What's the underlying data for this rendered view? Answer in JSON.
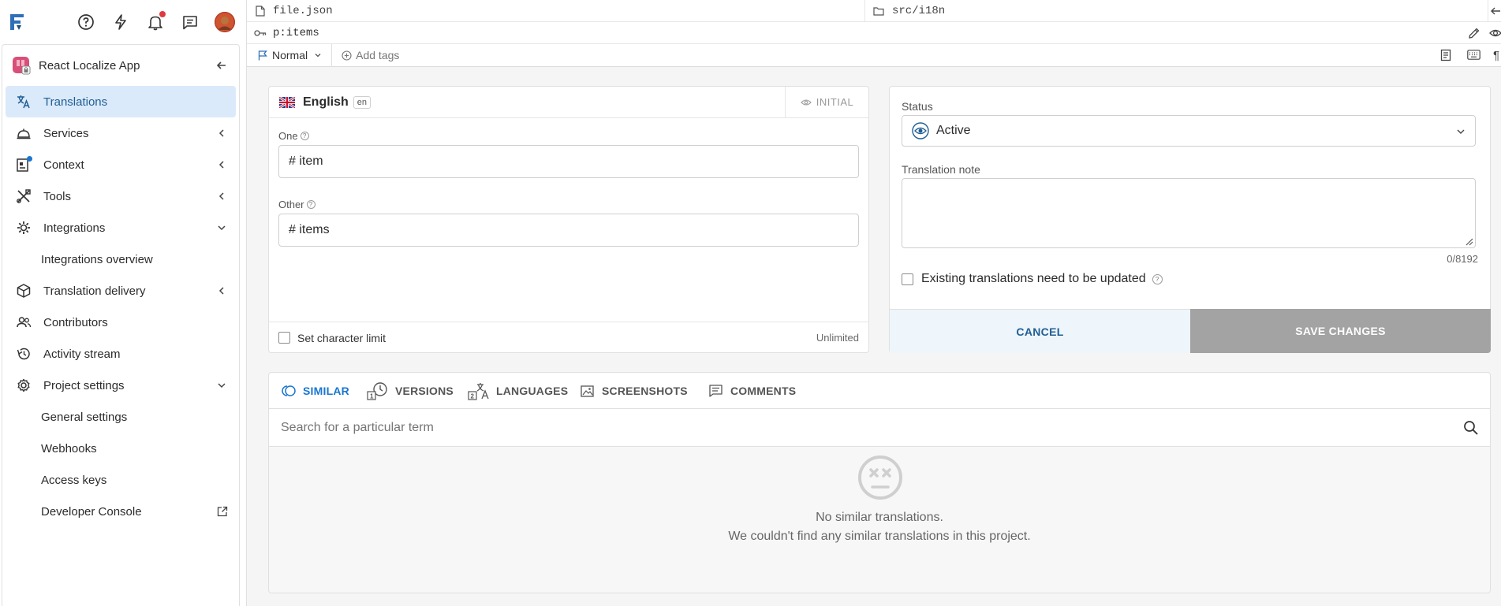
{
  "topbar": {
    "logo": "logo-icon",
    "icons": [
      "help-icon",
      "lightning-icon",
      "bell-icon",
      "chat-icon",
      "avatar"
    ]
  },
  "project": {
    "name": "React Localize App"
  },
  "nav": {
    "translations": "Translations",
    "services": "Services",
    "context": "Context",
    "tools": "Tools",
    "integrations": "Integrations",
    "integrations_overview": "Integrations overview",
    "translation_delivery": "Translation delivery",
    "contributors": "Contributors",
    "activity_stream": "Activity stream",
    "project_settings": "Project settings",
    "general_settings": "General settings",
    "webhooks": "Webhooks",
    "access_keys": "Access keys",
    "developer_console": "Developer Console"
  },
  "key": {
    "file": "file.json",
    "folder": "src/i18n",
    "name": "p:items",
    "priority": "Normal",
    "add_tags": "Add tags"
  },
  "editor": {
    "language": "English",
    "language_code": "en",
    "initial_badge": "INITIAL",
    "one_label": "One",
    "one_value": "# item",
    "other_label": "Other",
    "other_value": "# items",
    "char_limit_label": "Set character limit",
    "char_limit_value": "Unlimited"
  },
  "status_panel": {
    "status_label": "Status",
    "status_value": "Active",
    "note_label": "Translation note",
    "note_value": "",
    "counter": "0/8192",
    "existing_label": "Existing translations need to be updated",
    "cancel": "CANCEL",
    "save": "SAVE CHANGES"
  },
  "tabs": {
    "similar": "SIMILAR",
    "versions": "VERSIONS",
    "languages": "LANGUAGES",
    "screenshots": "SCREENSHOTS",
    "comments": "COMMENTS"
  },
  "search": {
    "placeholder": "Search for a particular term"
  },
  "empty": {
    "title": "No similar translations.",
    "subtitle": "We couldn't find any similar translations in this project."
  },
  "colors": {
    "accent": "#1976d2",
    "active_nav_bg": "#dbeafa",
    "save_bg": "#a3a3a3",
    "cancel_bg": "#eef5fb"
  }
}
